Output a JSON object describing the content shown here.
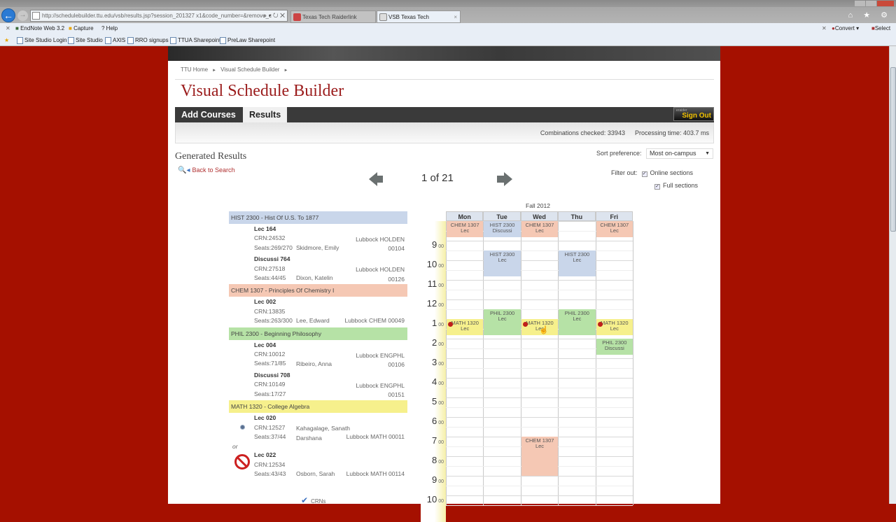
{
  "browser": {
    "url": "http://schedulebuilder.ttu.edu/vsb/results.jsp?session_201327 x1&code_number=&remove_c",
    "addr_controls": "⌕ ▾ ↻ ✕",
    "tabs": [
      {
        "label": "Texas Tech Raiderlink",
        "active": false
      },
      {
        "label": "VSB Texas Tech",
        "active": true
      }
    ],
    "right_icons": "⌂ ★ ⚙",
    "command_bar": {
      "close": "✕",
      "items": [
        "EndNote Web 3.2",
        "Capture",
        "? Help"
      ],
      "right_close": "✕",
      "convert": "Convert ▾",
      "select": "Select"
    },
    "favorites": [
      "Site Studio Login",
      "Site Studio",
      "AXIS",
      "RRO signups",
      "TTUA Sharepoint",
      "PreLaw Sharepoint"
    ]
  },
  "breadcrumb": [
    "TTU Home",
    "Visual Schedule Builder"
  ],
  "breadcrumb_sep": "►",
  "page_title": "Visual Schedule Builder",
  "nav_tabs": [
    {
      "label": "Add Courses",
      "active": false
    },
    {
      "label": "Results",
      "active": true
    }
  ],
  "signout": {
    "sub": "eraider",
    "label": "Sign Out"
  },
  "stats": {
    "combinations": "Combinations checked: 33943",
    "processing": "Processing time: 403.7 ms"
  },
  "results": {
    "heading": "Generated Results",
    "back_to_search": "Back to Search",
    "pager": "1 of 21",
    "sort_label": "Sort preference:",
    "sort_value": "Most on-campus",
    "filter_label": "Filter out:",
    "filter_options": [
      {
        "label": "Online sections",
        "checked": true
      },
      {
        "label": "Full sections",
        "checked": true
      }
    ],
    "crns_label": "CRNs"
  },
  "courses": [
    {
      "title": "HIST 2300 - Hist Of U.S. To 1877",
      "color": "#c9d6ea",
      "sections": [
        {
          "code": "Lec 164",
          "crn": "CRN:24532",
          "seats": "Seats:269/270",
          "instructor": "Skidmore, Emily",
          "location": "Lubbock HOLDEN 00104"
        },
        {
          "code": "Discussi 764",
          "crn": "CRN:27518",
          "seats": "Seats:44/45",
          "instructor": "Dixon, Katelin",
          "location": "Lubbock HOLDEN 00126"
        }
      ]
    },
    {
      "title": "CHEM 1307 - Principles Of Chemistry I",
      "color": "#f5c8b4",
      "sections": [
        {
          "code": "Lec 002",
          "crn": "CRN:13835",
          "seats": "Seats:263/300",
          "instructor": "Lee, Edward",
          "location": "Lubbock CHEM 00049"
        }
      ]
    },
    {
      "title": "PHIL 2300 - Beginning Philosophy",
      "color": "#b6e2a6",
      "sections": [
        {
          "code": "Lec 004",
          "crn": "CRN:10012",
          "seats": "Seats:71/85",
          "instructor": "Ribeiro, Anna",
          "location": "Lubbock ENGPHL 00106"
        },
        {
          "code": "Discussi 708",
          "crn": "CRN:10149",
          "seats": "Seats:17/27",
          "instructor": "",
          "location": "Lubbock ENGPHL 00151"
        }
      ]
    },
    {
      "title": "MATH 1320 - College Algebra",
      "color": "#f6f08c",
      "sections": [
        {
          "code": "Lec 020",
          "crn": "CRN:12527",
          "seats": "Seats:37/44",
          "instructor": "Kahagalage, Sanath Darshana",
          "location": "Lubbock MATH 00011",
          "selected": true
        },
        {
          "code": "Lec 022",
          "crn": "CRN:12534",
          "seats": "Seats:43/43",
          "instructor": "Osborn, Sarah",
          "location": "Lubbock MATH 00114",
          "full": true
        }
      ],
      "or_label": "or"
    }
  ],
  "calendar": {
    "semester": "Fall 2012",
    "days": [
      "Mon",
      "Tue",
      "Wed",
      "Thu",
      "Fri"
    ],
    "hours": [
      "9",
      "10",
      "11",
      "12",
      "1",
      "2",
      "3",
      "4",
      "5",
      "6",
      "7",
      "8",
      "9",
      "10"
    ],
    "minutes": "00",
    "events": [
      {
        "day": 0,
        "start": 8.5,
        "end": 9.33,
        "line1": "CHEM 1307",
        "line2": "Lec",
        "color": "#f5c8b4"
      },
      {
        "day": 2,
        "start": 8.5,
        "end": 9.33,
        "line1": "CHEM 1307",
        "line2": "Lec",
        "color": "#f5c8b4"
      },
      {
        "day": 4,
        "start": 8.5,
        "end": 9.33,
        "line1": "CHEM 1307",
        "line2": "Lec",
        "color": "#f5c8b4"
      },
      {
        "day": 1,
        "start": 8.5,
        "end": 9.33,
        "line1": "HIST 2300",
        "line2": "Discussi",
        "color": "#c9d6ea"
      },
      {
        "day": 1,
        "start": 10.0,
        "end": 11.33,
        "line1": "HIST 2300",
        "line2": "Lec",
        "color": "#c9d6ea"
      },
      {
        "day": 3,
        "start": 10.0,
        "end": 11.33,
        "line1": "HIST 2300",
        "line2": "Lec",
        "color": "#c9d6ea"
      },
      {
        "day": 1,
        "start": 13.0,
        "end": 14.33,
        "line1": "PHIL 2300",
        "line2": "Lec",
        "color": "#b6e2a6"
      },
      {
        "day": 3,
        "start": 13.0,
        "end": 14.33,
        "line1": "PHIL 2300",
        "line2": "Lec",
        "color": "#b6e2a6"
      },
      {
        "day": 4,
        "start": 14.5,
        "end": 15.33,
        "line1": "PHIL 2300",
        "line2": "Discussi",
        "color": "#b6e2a6"
      },
      {
        "day": 0,
        "start": 13.5,
        "end": 14.33,
        "line1": "MATH 1320",
        "line2": "Lec",
        "color": "#f6f08c",
        "pinned": true
      },
      {
        "day": 2,
        "start": 13.5,
        "end": 14.33,
        "line1": "MATH 1320",
        "line2": "Lec",
        "color": "#f6f08c",
        "pinned": true
      },
      {
        "day": 4,
        "start": 13.5,
        "end": 14.33,
        "line1": "MATH 1320",
        "line2": "Lec",
        "color": "#f6f08c",
        "pinned": true
      },
      {
        "day": 2,
        "start": 19.5,
        "end": 21.5,
        "line1": "CHEM 1307",
        "line2": "Lec",
        "color": "#f5c8b4"
      }
    ]
  }
}
